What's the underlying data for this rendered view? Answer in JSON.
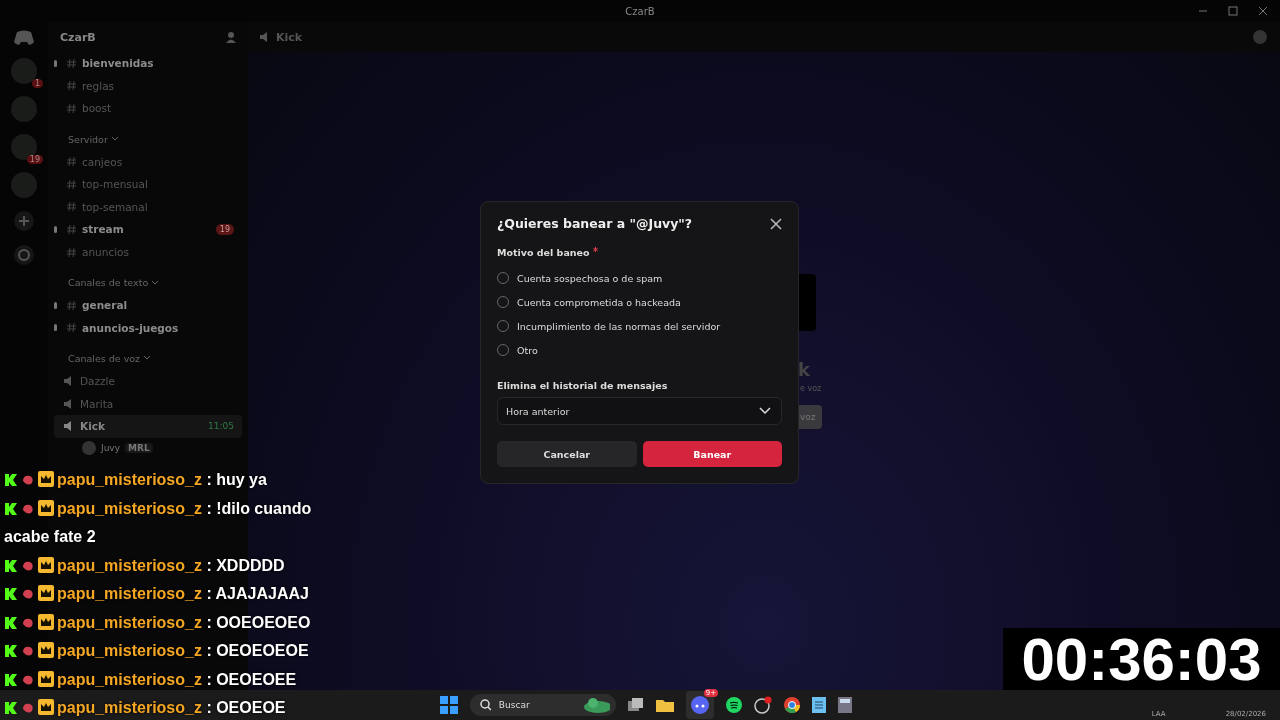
{
  "titlebar": {
    "title": "CzarB"
  },
  "server_rail": {
    "servers": [
      {
        "kind": "avatar",
        "badge": "1"
      },
      {
        "kind": "avatar"
      },
      {
        "kind": "avatar",
        "badge": "19"
      },
      {
        "kind": "avatar"
      }
    ]
  },
  "sidebar": {
    "server_name": "CzarB",
    "channels": [
      {
        "name": "bienvenidas",
        "unread": true
      },
      {
        "name": "reglas",
        "unread": false
      },
      {
        "name": "boost",
        "unread": false
      }
    ],
    "categories": [
      {
        "name": "Servidor",
        "channels": [
          {
            "name": "canjeos",
            "unread": false
          },
          {
            "name": "top-mensual",
            "unread": false
          },
          {
            "name": "top-semanal",
            "unread": false
          },
          {
            "name": "stream",
            "unread": true,
            "badge": "19"
          },
          {
            "name": "anuncios",
            "unread": false
          }
        ]
      },
      {
        "name": "Canales de texto",
        "channels": [
          {
            "name": "general",
            "unread": true
          },
          {
            "name": "anuncios-juegos",
            "unread": true
          }
        ]
      }
    ],
    "voice_category": {
      "name": "Canales de voz",
      "channels": [
        {
          "name": "Dazzle",
          "selected": false
        },
        {
          "name": "Marita",
          "selected": false
        },
        {
          "name": "Kick",
          "selected": true,
          "time": "11:05"
        }
      ],
      "users": [
        {
          "name": "Juvy",
          "tag": "MRL"
        }
      ]
    }
  },
  "main": {
    "channel": "Kick",
    "behind_dialog": {
      "title": "k",
      "subtitle": "e voz",
      "button": "voz"
    }
  },
  "dialog": {
    "title": "¿Quieres banear a \"@Juvy\"?",
    "reason_label": "Motivo del baneo",
    "required": true,
    "reasons": [
      {
        "label": "Cuenta sospechosa o de spam",
        "selected": false
      },
      {
        "label": "Cuenta comprometida o hackeada",
        "selected": false
      },
      {
        "label": "Incumplimiento de las normas del servidor",
        "selected": false
      },
      {
        "label": "Otro",
        "selected": false
      }
    ],
    "history_label": "Elimina el historial de mensajes",
    "history_value": "Hora anterior",
    "buttons": [
      {
        "label": "Cancelar",
        "kind": "secondary"
      },
      {
        "label": "Banear",
        "kind": "danger"
      }
    ]
  },
  "chat_overlay": {
    "messages": [
      {
        "user": "papu_misterioso_z",
        "text": ": huy ya"
      },
      {
        "user": "papu_misterioso_z",
        "text": ": !dilo cuando acabe fate 2"
      },
      {
        "user": "papu_misterioso_z",
        "text": ": XDDDDD"
      },
      {
        "user": "papu_misterioso_z",
        "text": ": AJAJAJAAJ"
      },
      {
        "user": "papu_misterioso_z",
        "text": ": OOEOEOEO"
      },
      {
        "user": "papu_misterioso_z",
        "text": ": OEOEOEOE"
      },
      {
        "user": "papu_misterioso_z",
        "text": ": OEOEOEE"
      },
      {
        "user": "papu_misterioso_z",
        "text": ": OEOEOE"
      }
    ]
  },
  "timer": "00:36:03",
  "taskbar": {
    "search_placeholder": "Buscar",
    "discord_badge": "9+",
    "tray_label": "LAA",
    "date": "28/02/2026"
  }
}
